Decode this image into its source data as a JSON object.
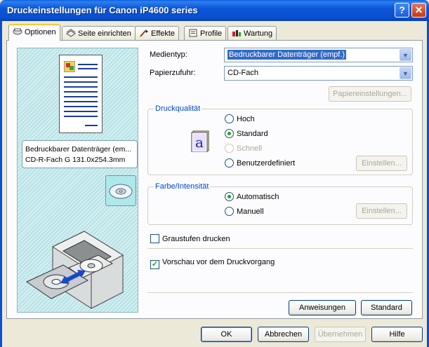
{
  "window": {
    "title": "Druckeinstellungen für Canon iP4600 series"
  },
  "tabs": [
    {
      "label": "Optionen",
      "icon": "quick-setup-icon"
    },
    {
      "label": "Seite einrichten",
      "icon": "page-setup-icon"
    },
    {
      "label": "Effekte",
      "icon": "effects-icon"
    },
    {
      "label": "Profile",
      "icon": "profile-icon"
    },
    {
      "label": "Wartung",
      "icon": "maintenance-icon"
    }
  ],
  "preview": {
    "info_line1": "Bedruckbarer Datenträger (em...",
    "info_line2": "CD-R-Fach G 131.0x254.3mm"
  },
  "media": {
    "label": "Medientyp:",
    "value": "Bedruckbarer Datenträger (empf.)",
    "paper_source_label": "Papierzufuhr:",
    "paper_source_value": "CD-Fach",
    "paper_settings_button": "Papiereinstellungen..."
  },
  "quality": {
    "title": "Druckqualität",
    "options": [
      "Hoch",
      "Standard",
      "Schnell",
      "Benutzerdefiniert"
    ],
    "selected": "Standard",
    "settings_button": "Einstellen..."
  },
  "color": {
    "title": "Farbe/Intensität",
    "options": [
      "Automatisch",
      "Manuell"
    ],
    "selected": "Automatisch",
    "settings_button": "Einstellen..."
  },
  "grayscale": {
    "label": "Graustufen drucken",
    "checked": false
  },
  "preview_before": {
    "label": "Vorschau vor dem Druckvorgang",
    "checked": true
  },
  "buttons": {
    "instructions": "Anweisungen",
    "defaults": "Standard",
    "ok": "OK",
    "cancel": "Abbrechen",
    "apply": "Übernehmen",
    "help": "Hilfe"
  },
  "colors": {
    "title_bar": "#0b56d6",
    "selection": "#316ac5",
    "group_title": "#0046d5"
  }
}
